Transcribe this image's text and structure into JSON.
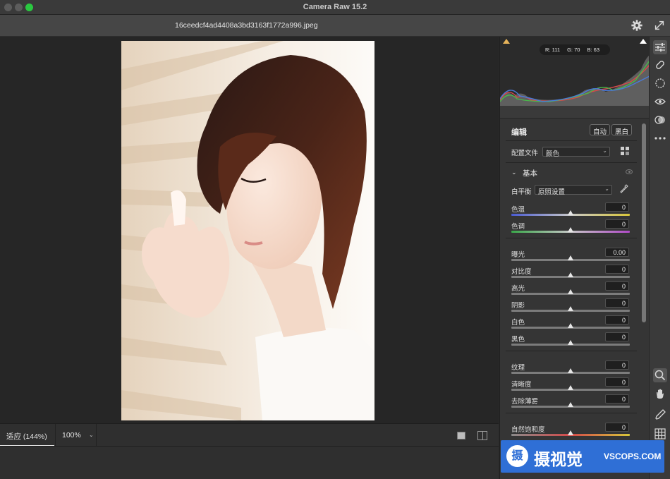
{
  "window": {
    "title": "Camera Raw 15.2",
    "file_name": "16ceedcf4ad4408a3bd3163f1772a996.jpeg"
  },
  "bottom_bar": {
    "zoom_fit": "适应 (144%)",
    "zoom_100": "100%"
  },
  "histogram": {
    "r_label": "R: 111",
    "g_label": "G: 70",
    "b_label": "B: 63"
  },
  "edit_panel": {
    "title": "编辑",
    "auto_button": "自动",
    "bw_button": "黑白",
    "profile_label": "配置文件",
    "profile_value": "颜色",
    "section_basic": "基本",
    "wb_label": "白平衡",
    "wb_value": "原照设置",
    "sliders": [
      {
        "label": "色温",
        "value": "0",
        "position": 0.5
      },
      {
        "label": "色调",
        "value": "0",
        "position": 0.5
      },
      {
        "label": "曝光",
        "value": "0.00",
        "position": 0.5
      },
      {
        "label": "对比度",
        "value": "0",
        "position": 0.5
      },
      {
        "label": "高光",
        "value": "0",
        "position": 0.5
      },
      {
        "label": "阴影",
        "value": "0",
        "position": 0.5
      },
      {
        "label": "白色",
        "value": "0",
        "position": 0.5
      },
      {
        "label": "黑色",
        "value": "0",
        "position": 0.5
      },
      {
        "label": "纹理",
        "value": "0",
        "position": 0.5
      },
      {
        "label": "清晰度",
        "value": "0",
        "position": 0.5
      },
      {
        "label": "去除薄雾",
        "value": "0",
        "position": 0.5
      },
      {
        "label": "自然饱和度",
        "value": "0",
        "position": 0.5
      }
    ]
  },
  "toolbar": {
    "tools": [
      "edit-sliders-icon",
      "heal-bandage-icon",
      "mask-icon",
      "red-eye-icon",
      "presets-icon",
      "more-icon",
      "zoom-icon",
      "hand-icon",
      "color-sampler-icon",
      "grid-icon"
    ]
  },
  "watermark": {
    "badge": "摄",
    "text": "摄视觉",
    "url": "VSCOPS.COM"
  },
  "colors": {
    "accent": "#2f6fd6",
    "panel": "#353535",
    "canvas": "#262626"
  }
}
